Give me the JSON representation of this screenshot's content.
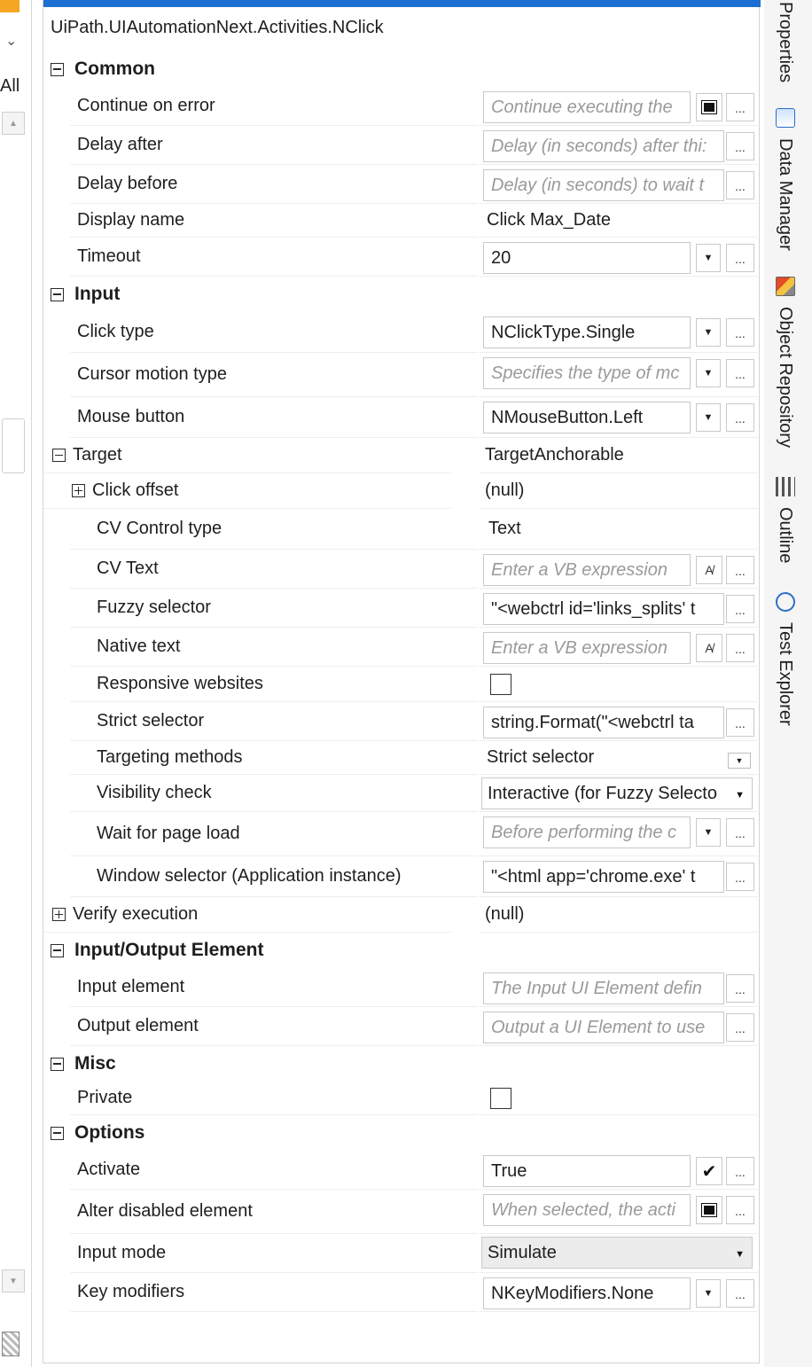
{
  "activity_type": "UiPath.UIAutomationNext.Activities.NClick",
  "left_strip": {
    "filter_label": "All"
  },
  "categories": {
    "common": "Common",
    "input": "Input",
    "io_element": "Input/Output Element",
    "misc": "Misc",
    "options": "Options"
  },
  "props": {
    "continue_on_error": {
      "name": "Continue on error",
      "placeholder": "Continue executing the"
    },
    "delay_after": {
      "name": "Delay after",
      "placeholder": "Delay (in seconds) after thi:"
    },
    "delay_before": {
      "name": "Delay before",
      "placeholder": "Delay (in seconds) to wait t"
    },
    "display_name": {
      "name": "Display name",
      "value": "Click Max_Date"
    },
    "timeout": {
      "name": "Timeout",
      "value": "20"
    },
    "click_type": {
      "name": "Click type",
      "value": "NClickType.Single"
    },
    "cursor_motion_type": {
      "name": "Cursor motion type",
      "placeholder": "Specifies the type of mc"
    },
    "mouse_button": {
      "name": "Mouse button",
      "value": "NMouseButton.Left"
    },
    "target": {
      "name": "Target",
      "value": "TargetAnchorable"
    },
    "click_offset": {
      "name": "Click offset",
      "value": "(null)"
    },
    "cv_control_type": {
      "name": "CV Control type",
      "value": "Text"
    },
    "cv_text": {
      "name": "CV Text",
      "placeholder": "Enter a VB expression"
    },
    "fuzzy_selector": {
      "name": "Fuzzy selector",
      "value": "\"<webctrl id='links_splits' t"
    },
    "native_text": {
      "name": "Native text",
      "placeholder": "Enter a VB expression"
    },
    "responsive_websites": {
      "name": "Responsive websites",
      "checked": false
    },
    "strict_selector": {
      "name": "Strict selector",
      "value": "string.Format(\"<webctrl ta"
    },
    "targeting_methods": {
      "name": "Targeting methods",
      "value": "Strict selector"
    },
    "visibility_check": {
      "name": "Visibility check",
      "value": "Interactive (for Fuzzy Selecto"
    },
    "wait_for_page_load": {
      "name": "Wait for page load",
      "placeholder": "Before performing the c"
    },
    "window_selector": {
      "name": "Window selector (Application instance)",
      "value": "\"<html app='chrome.exe' t"
    },
    "verify_execution": {
      "name": "Verify execution",
      "value": "(null)"
    },
    "input_element": {
      "name": "Input element",
      "placeholder": "The Input UI Element defin"
    },
    "output_element": {
      "name": "Output element",
      "placeholder": "Output a UI Element to use"
    },
    "private": {
      "name": "Private",
      "checked": false
    },
    "activate": {
      "name": "Activate",
      "value": "True",
      "checked": true
    },
    "alter_disabled_element": {
      "name": "Alter disabled element",
      "placeholder": "When selected, the acti"
    },
    "input_mode": {
      "name": "Input mode",
      "value": "Simulate"
    },
    "key_modifiers": {
      "name": "Key modifiers",
      "value": "NKeyModifiers.None"
    }
  },
  "buttons": {
    "ellipsis": "...",
    "dropdown": "▼"
  },
  "side_tabs": [
    "Properties",
    "Data Manager",
    "Object Repository",
    "Outline",
    "Test Explorer"
  ],
  "colors": {
    "title_bar": "#1c6fd1",
    "placeholder": "#9a9a9a"
  }
}
